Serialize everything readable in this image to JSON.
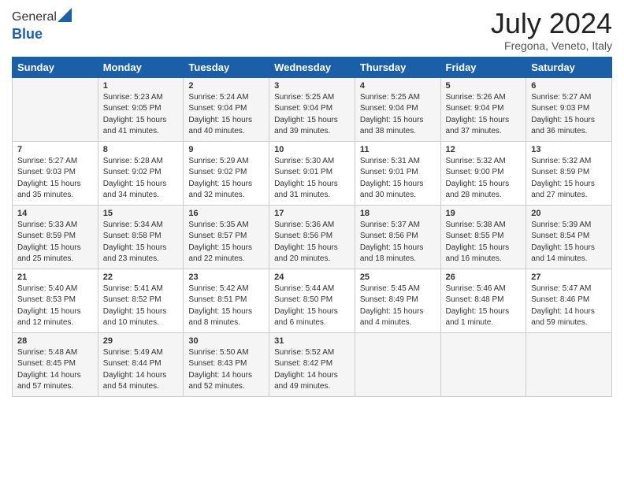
{
  "header": {
    "logo_general": "General",
    "logo_blue": "Blue",
    "month_title": "July 2024",
    "location": "Fregona, Veneto, Italy"
  },
  "days_of_week": [
    "Sunday",
    "Monday",
    "Tuesday",
    "Wednesday",
    "Thursday",
    "Friday",
    "Saturday"
  ],
  "weeks": [
    [
      {
        "day": "",
        "sunrise": "",
        "sunset": "",
        "daylight": ""
      },
      {
        "day": "1",
        "sunrise": "Sunrise: 5:23 AM",
        "sunset": "Sunset: 9:05 PM",
        "daylight": "Daylight: 15 hours and 41 minutes."
      },
      {
        "day": "2",
        "sunrise": "Sunrise: 5:24 AM",
        "sunset": "Sunset: 9:04 PM",
        "daylight": "Daylight: 15 hours and 40 minutes."
      },
      {
        "day": "3",
        "sunrise": "Sunrise: 5:25 AM",
        "sunset": "Sunset: 9:04 PM",
        "daylight": "Daylight: 15 hours and 39 minutes."
      },
      {
        "day": "4",
        "sunrise": "Sunrise: 5:25 AM",
        "sunset": "Sunset: 9:04 PM",
        "daylight": "Daylight: 15 hours and 38 minutes."
      },
      {
        "day": "5",
        "sunrise": "Sunrise: 5:26 AM",
        "sunset": "Sunset: 9:04 PM",
        "daylight": "Daylight: 15 hours and 37 minutes."
      },
      {
        "day": "6",
        "sunrise": "Sunrise: 5:27 AM",
        "sunset": "Sunset: 9:03 PM",
        "daylight": "Daylight: 15 hours and 36 minutes."
      }
    ],
    [
      {
        "day": "7",
        "sunrise": "Sunrise: 5:27 AM",
        "sunset": "Sunset: 9:03 PM",
        "daylight": "Daylight: 15 hours and 35 minutes."
      },
      {
        "day": "8",
        "sunrise": "Sunrise: 5:28 AM",
        "sunset": "Sunset: 9:02 PM",
        "daylight": "Daylight: 15 hours and 34 minutes."
      },
      {
        "day": "9",
        "sunrise": "Sunrise: 5:29 AM",
        "sunset": "Sunset: 9:02 PM",
        "daylight": "Daylight: 15 hours and 32 minutes."
      },
      {
        "day": "10",
        "sunrise": "Sunrise: 5:30 AM",
        "sunset": "Sunset: 9:01 PM",
        "daylight": "Daylight: 15 hours and 31 minutes."
      },
      {
        "day": "11",
        "sunrise": "Sunrise: 5:31 AM",
        "sunset": "Sunset: 9:01 PM",
        "daylight": "Daylight: 15 hours and 30 minutes."
      },
      {
        "day": "12",
        "sunrise": "Sunrise: 5:32 AM",
        "sunset": "Sunset: 9:00 PM",
        "daylight": "Daylight: 15 hours and 28 minutes."
      },
      {
        "day": "13",
        "sunrise": "Sunrise: 5:32 AM",
        "sunset": "Sunset: 8:59 PM",
        "daylight": "Daylight: 15 hours and 27 minutes."
      }
    ],
    [
      {
        "day": "14",
        "sunrise": "Sunrise: 5:33 AM",
        "sunset": "Sunset: 8:59 PM",
        "daylight": "Daylight: 15 hours and 25 minutes."
      },
      {
        "day": "15",
        "sunrise": "Sunrise: 5:34 AM",
        "sunset": "Sunset: 8:58 PM",
        "daylight": "Daylight: 15 hours and 23 minutes."
      },
      {
        "day": "16",
        "sunrise": "Sunrise: 5:35 AM",
        "sunset": "Sunset: 8:57 PM",
        "daylight": "Daylight: 15 hours and 22 minutes."
      },
      {
        "day": "17",
        "sunrise": "Sunrise: 5:36 AM",
        "sunset": "Sunset: 8:56 PM",
        "daylight": "Daylight: 15 hours and 20 minutes."
      },
      {
        "day": "18",
        "sunrise": "Sunrise: 5:37 AM",
        "sunset": "Sunset: 8:56 PM",
        "daylight": "Daylight: 15 hours and 18 minutes."
      },
      {
        "day": "19",
        "sunrise": "Sunrise: 5:38 AM",
        "sunset": "Sunset: 8:55 PM",
        "daylight": "Daylight: 15 hours and 16 minutes."
      },
      {
        "day": "20",
        "sunrise": "Sunrise: 5:39 AM",
        "sunset": "Sunset: 8:54 PM",
        "daylight": "Daylight: 15 hours and 14 minutes."
      }
    ],
    [
      {
        "day": "21",
        "sunrise": "Sunrise: 5:40 AM",
        "sunset": "Sunset: 8:53 PM",
        "daylight": "Daylight: 15 hours and 12 minutes."
      },
      {
        "day": "22",
        "sunrise": "Sunrise: 5:41 AM",
        "sunset": "Sunset: 8:52 PM",
        "daylight": "Daylight: 15 hours and 10 minutes."
      },
      {
        "day": "23",
        "sunrise": "Sunrise: 5:42 AM",
        "sunset": "Sunset: 8:51 PM",
        "daylight": "Daylight: 15 hours and 8 minutes."
      },
      {
        "day": "24",
        "sunrise": "Sunrise: 5:44 AM",
        "sunset": "Sunset: 8:50 PM",
        "daylight": "Daylight: 15 hours and 6 minutes."
      },
      {
        "day": "25",
        "sunrise": "Sunrise: 5:45 AM",
        "sunset": "Sunset: 8:49 PM",
        "daylight": "Daylight: 15 hours and 4 minutes."
      },
      {
        "day": "26",
        "sunrise": "Sunrise: 5:46 AM",
        "sunset": "Sunset: 8:48 PM",
        "daylight": "Daylight: 15 hours and 1 minute."
      },
      {
        "day": "27",
        "sunrise": "Sunrise: 5:47 AM",
        "sunset": "Sunset: 8:46 PM",
        "daylight": "Daylight: 14 hours and 59 minutes."
      }
    ],
    [
      {
        "day": "28",
        "sunrise": "Sunrise: 5:48 AM",
        "sunset": "Sunset: 8:45 PM",
        "daylight": "Daylight: 14 hours and 57 minutes."
      },
      {
        "day": "29",
        "sunrise": "Sunrise: 5:49 AM",
        "sunset": "Sunset: 8:44 PM",
        "daylight": "Daylight: 14 hours and 54 minutes."
      },
      {
        "day": "30",
        "sunrise": "Sunrise: 5:50 AM",
        "sunset": "Sunset: 8:43 PM",
        "daylight": "Daylight: 14 hours and 52 minutes."
      },
      {
        "day": "31",
        "sunrise": "Sunrise: 5:52 AM",
        "sunset": "Sunset: 8:42 PM",
        "daylight": "Daylight: 14 hours and 49 minutes."
      },
      {
        "day": "",
        "sunrise": "",
        "sunset": "",
        "daylight": ""
      },
      {
        "day": "",
        "sunrise": "",
        "sunset": "",
        "daylight": ""
      },
      {
        "day": "",
        "sunrise": "",
        "sunset": "",
        "daylight": ""
      }
    ]
  ]
}
